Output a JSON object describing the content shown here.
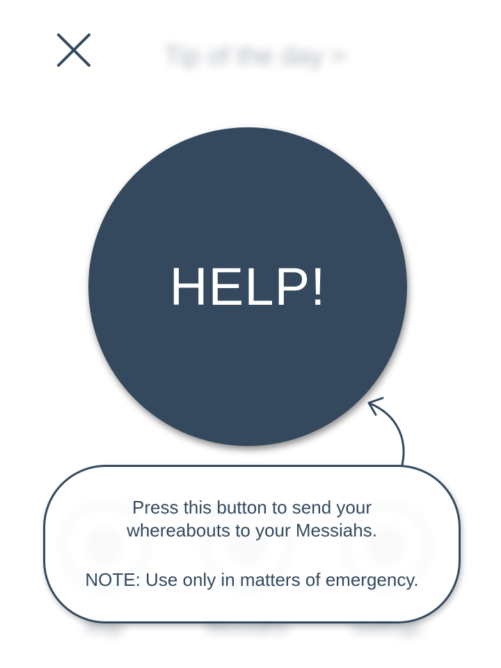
{
  "header": {
    "close_icon": "close-icon",
    "tip_label": "Tip of the day >"
  },
  "help_button": {
    "label": "HELP!",
    "color": "#34495e"
  },
  "nav": {
    "items": [
      {
        "label": "Map",
        "icon": "map-icon"
      },
      {
        "label": "Messiahs",
        "icon": "people-icon"
      },
      {
        "label": "Settings",
        "icon": "gear-icon"
      }
    ]
  },
  "tooltip": {
    "line1": "Press this button to send your",
    "line2": "whereabouts to your Messiahs.",
    "note_label": "NOTE",
    "note_text": ": Use only in matters of emergency.",
    "border_color": "#34495e"
  }
}
